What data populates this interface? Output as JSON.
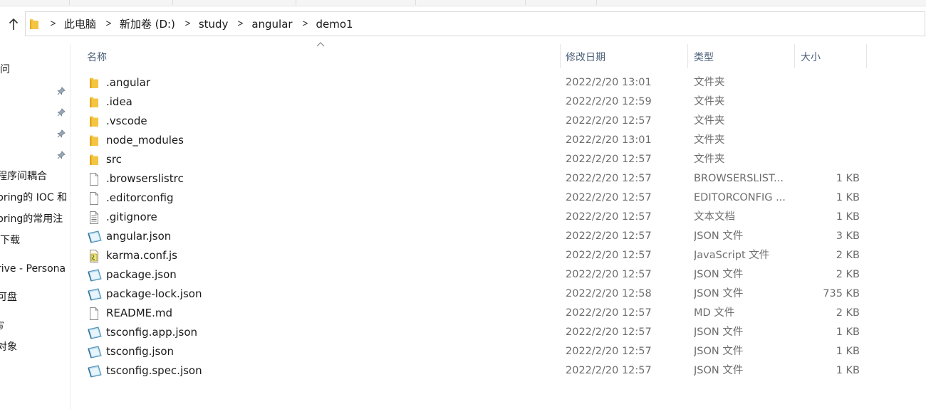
{
  "breadcrumb": [
    "此电脑",
    "新加卷 (D:)",
    "study",
    "angular",
    "demo1"
  ],
  "sidebar": {
    "items": [
      {
        "label": "问",
        "pinned": false
      },
      {
        "label": "",
        "pinned": true
      },
      {
        "label": "",
        "pinned": true
      },
      {
        "label": "",
        "pinned": true
      },
      {
        "label": "",
        "pinned": true
      },
      {
        "label": "程序间耦合",
        "pinned": false
      },
      {
        "label": "pring的 IOC 和",
        "pinned": false
      },
      {
        "label": "pring的常用注",
        "pinned": false
      },
      {
        "label": "下载",
        "pinned": false
      },
      {
        "label": "rive - Persona",
        "pinned": false
      },
      {
        "label": "可盘",
        "pinned": false
      },
      {
        "label": "写",
        "pinned": false
      },
      {
        "label": "对象",
        "pinned": false
      }
    ]
  },
  "columns": {
    "name": "名称",
    "modified": "修改日期",
    "type": "类型",
    "size": "大小"
  },
  "files": [
    {
      "name": ".angular",
      "date": "2022/2/20 13:01",
      "type": "文件夹",
      "size": "",
      "icon": "folder-icon"
    },
    {
      "name": ".idea",
      "date": "2022/2/20 12:59",
      "type": "文件夹",
      "size": "",
      "icon": "folder-icon"
    },
    {
      "name": ".vscode",
      "date": "2022/2/20 12:57",
      "type": "文件夹",
      "size": "",
      "icon": "folder-icon"
    },
    {
      "name": "node_modules",
      "date": "2022/2/20 13:01",
      "type": "文件夹",
      "size": "",
      "icon": "folder-icon"
    },
    {
      "name": "src",
      "date": "2022/2/20 12:57",
      "type": "文件夹",
      "size": "",
      "icon": "folder-icon"
    },
    {
      "name": ".browserslistrc",
      "date": "2022/2/20 12:57",
      "type": "BROWSERSLIST...",
      "size": "1 KB",
      "icon": "blank-file-icon"
    },
    {
      "name": ".editorconfig",
      "date": "2022/2/20 12:57",
      "type": "EDITORCONFIG ...",
      "size": "1 KB",
      "icon": "blank-file-icon"
    },
    {
      "name": ".gitignore",
      "date": "2022/2/20 12:57",
      "type": "文本文档",
      "size": "1 KB",
      "icon": "text-file-icon"
    },
    {
      "name": "angular.json",
      "date": "2022/2/20 12:57",
      "type": "JSON 文件",
      "size": "3 KB",
      "icon": "json-file-icon"
    },
    {
      "name": "karma.conf.js",
      "date": "2022/2/20 12:57",
      "type": "JavaScript 文件",
      "size": "2 KB",
      "icon": "script-file-icon"
    },
    {
      "name": "package.json",
      "date": "2022/2/20 12:57",
      "type": "JSON 文件",
      "size": "2 KB",
      "icon": "json-file-icon"
    },
    {
      "name": "package-lock.json",
      "date": "2022/2/20 12:58",
      "type": "JSON 文件",
      "size": "735 KB",
      "icon": "json-file-icon"
    },
    {
      "name": "README.md",
      "date": "2022/2/20 12:57",
      "type": "MD 文件",
      "size": "2 KB",
      "icon": "blank-file-icon"
    },
    {
      "name": "tsconfig.app.json",
      "date": "2022/2/20 12:57",
      "type": "JSON 文件",
      "size": "1 KB",
      "icon": "json-file-icon"
    },
    {
      "name": "tsconfig.json",
      "date": "2022/2/20 12:57",
      "type": "JSON 文件",
      "size": "1 KB",
      "icon": "json-file-icon"
    },
    {
      "name": "tsconfig.spec.json",
      "date": "2022/2/20 12:57",
      "type": "JSON 文件",
      "size": "1 KB",
      "icon": "json-file-icon"
    }
  ],
  "colors": {
    "header_text": "#4c607a",
    "folder": "#f4c542",
    "meta_text": "#6d6d6d"
  }
}
